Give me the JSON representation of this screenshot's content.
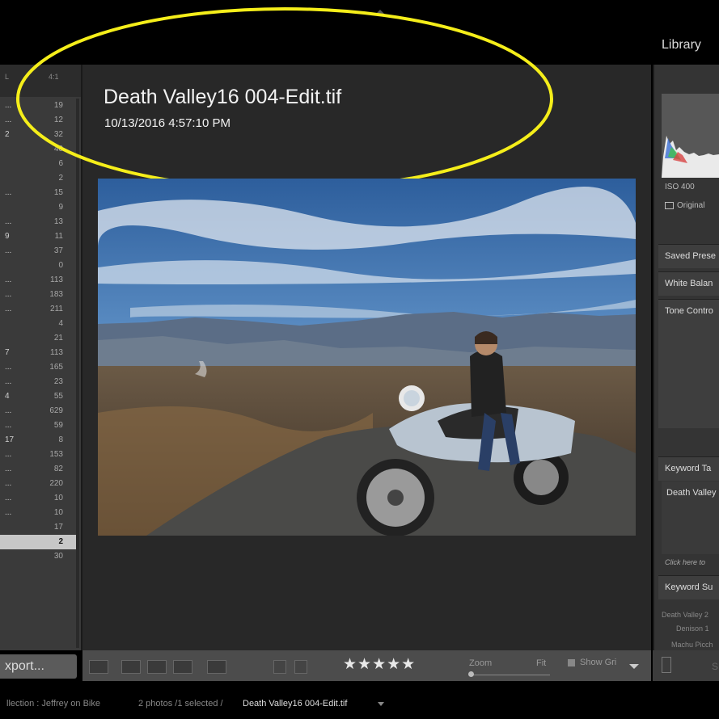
{
  "header": {
    "module_label": "Library"
  },
  "left_panel": {
    "zoom_ratio": "4:1",
    "zoom_left": "L",
    "rows": [
      {
        "frag": "...",
        "count": "19"
      },
      {
        "frag": "...",
        "count": "12"
      },
      {
        "frag": "2",
        "count": "32"
      },
      {
        "frag": "",
        "count": "40"
      },
      {
        "frag": "",
        "count": "6"
      },
      {
        "frag": "",
        "count": "2"
      },
      {
        "frag": "...",
        "count": "15"
      },
      {
        "frag": "",
        "count": "9"
      },
      {
        "frag": "...",
        "count": "13"
      },
      {
        "frag": "9",
        "count": "11"
      },
      {
        "frag": "...",
        "count": "37"
      },
      {
        "frag": "",
        "count": "0"
      },
      {
        "frag": "...",
        "count": "113"
      },
      {
        "frag": "...",
        "count": "183"
      },
      {
        "frag": "...",
        "count": "211"
      },
      {
        "frag": "",
        "count": "4"
      },
      {
        "frag": "",
        "count": "21"
      },
      {
        "frag": "7",
        "count": "113"
      },
      {
        "frag": "...",
        "count": "165"
      },
      {
        "frag": "...",
        "count": "23"
      },
      {
        "frag": "4",
        "count": "55"
      },
      {
        "frag": "...",
        "count": "629"
      },
      {
        "frag": "...",
        "count": "59"
      },
      {
        "frag": "17",
        "count": "8"
      },
      {
        "frag": "...",
        "count": "153"
      },
      {
        "frag": "...",
        "count": "82"
      },
      {
        "frag": "...",
        "count": "220"
      },
      {
        "frag": "...",
        "count": "10"
      },
      {
        "frag": "...",
        "count": "10"
      },
      {
        "frag": "",
        "count": "17"
      },
      {
        "frag": "",
        "count": "2"
      },
      {
        "frag": "",
        "count": "30"
      }
    ],
    "export_label": "xport..."
  },
  "loupe": {
    "file_title": "Death Valley16 004-Edit.tif",
    "file_date": "10/13/2016 4:57:10 PM"
  },
  "right_panel": {
    "iso": "ISO 400",
    "original": "Original",
    "saved_preset": "Saved Prese",
    "white_balance": "White Balan",
    "tone_control": "Tone Contro",
    "keyword_tag": "Keyword Ta",
    "keyword_text": "Death Valley",
    "click_here": "Click here to",
    "keyword_sug": "Keyword Su",
    "kw_sug_1": "Death Valley 2",
    "kw_sug_2": "Denison 1",
    "kw_sug_3": "Machu Picch"
  },
  "toolbar": {
    "stars": "★★★★★",
    "zoom_label": "Zoom",
    "fit_label": "Fit",
    "show_grid": "Show Gri",
    "right_s": "S"
  },
  "filmstrip": {
    "collection": "llection : Jeffrey on Bike",
    "count": "2 photos /1 selected /",
    "filename": "Death Valley16 004-Edit.tif"
  },
  "colors": {
    "annotation": "#ffff00",
    "sky": "#3a6aa6",
    "road": "#4a4a48"
  }
}
